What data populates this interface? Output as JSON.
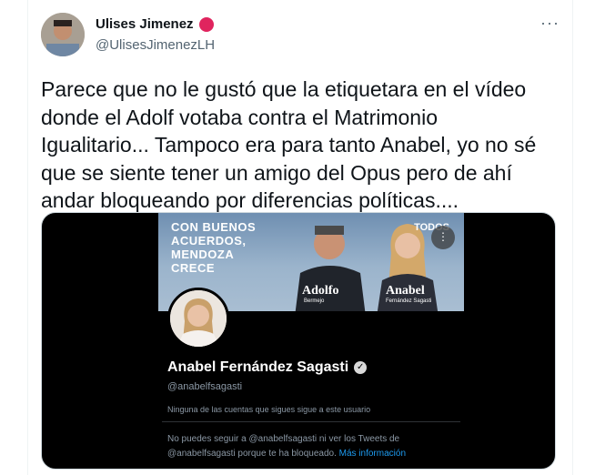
{
  "tweet": {
    "author_name": "Ulises Jimenez",
    "author_handle": "@UlisesJimenezLH",
    "more_icon": "more-horizontal-icon",
    "text": "Parece que no le gustó que la etiquetara en el vídeo\ndonde el Adolf votaba contra el Matrimonio\nIgualitario... Tampoco era para tanto Anabel, yo no sé\nque se siente tener un amigo del Opus pero de ahí\nandar bloqueando por diferencias políticas...."
  },
  "media": {
    "banner": {
      "slogan": "CON BUENOS ACUERDOS, MENDOZA CRECE",
      "brand": "TODOS",
      "candidate1": "Adolfo",
      "candidate1_sub": "Bermejo",
      "candidate2": "Anabel",
      "candidate2_sub": "Fernández Sagasti"
    },
    "profile_name": "Anabel Fernández Sagasti",
    "profile_handle": "@anabelfsagasti",
    "follow_note": "Ninguna de las cuentas que sigues sigue a este usuario",
    "blocked_text": "No puedes seguir a @anabelfsagasti ni ver los Tweets de @anabelfsagasti porque te ha bloqueado.",
    "blocked_link": "Más información"
  },
  "colors": {
    "accent": "#1d9bf0",
    "badge": "#e0245e"
  }
}
